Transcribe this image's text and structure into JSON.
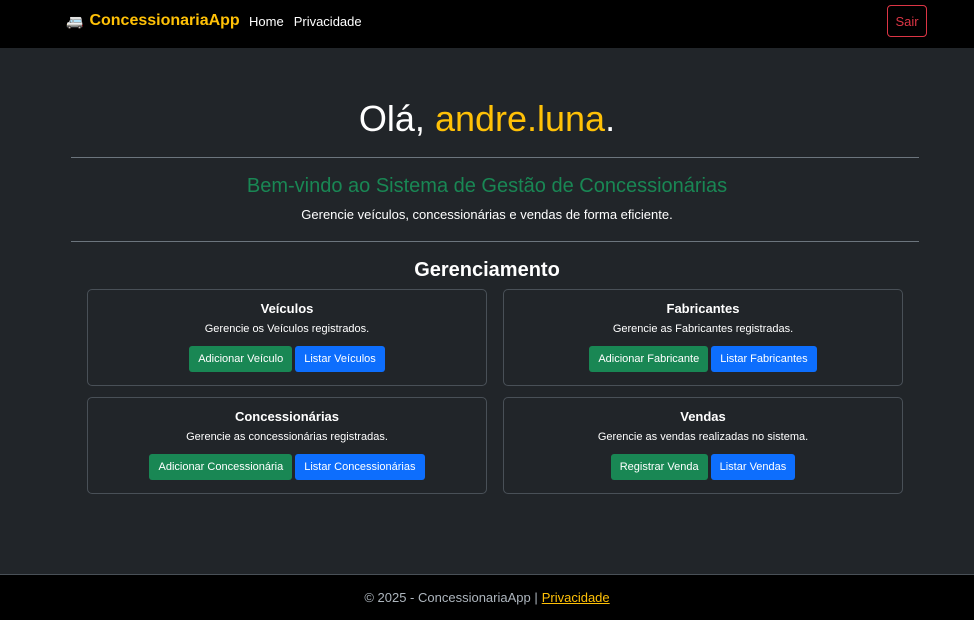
{
  "navbar": {
    "brand_icon": "🚐",
    "brand": "ConcessionariaApp",
    "links": [
      "Home",
      "Privacidade"
    ],
    "logout_label": "Sair"
  },
  "hero": {
    "greeting_prefix": "Olá, ",
    "username": "andre.luna",
    "greeting_suffix": ".",
    "welcome": "Bem-vindo ao Sistema de Gestão de Concessionárias",
    "subtitle": "Gerencie veículos, concessionárias e vendas de forma eficiente."
  },
  "management": {
    "title": "Gerenciamento",
    "cards": [
      {
        "title": "Veículos",
        "text": "Gerencie os Veículos registrados.",
        "add": "Adicionar Veículo",
        "list": "Listar Veículos"
      },
      {
        "title": "Fabricantes",
        "text": "Gerencie as Fabricantes registradas.",
        "add": "Adicionar Fabricante",
        "list": "Listar Fabricantes"
      },
      {
        "title": "Concessionárias",
        "text": "Gerencie as concessionárias registradas.",
        "add": "Adicionar Concessionária",
        "list": "Listar Concessionárias"
      },
      {
        "title": "Vendas",
        "text": "Gerencie as vendas realizadas no sistema.",
        "add": "Registrar Venda",
        "list": "Listar Vendas"
      }
    ]
  },
  "footer": {
    "text": "© 2025 - ConcessionariaApp |",
    "link": "Privacidade"
  },
  "colors": {
    "brand": "#ffc107",
    "success": "#198754",
    "primary": "#0d6efd",
    "danger": "#dc3545",
    "background": "#212529"
  }
}
